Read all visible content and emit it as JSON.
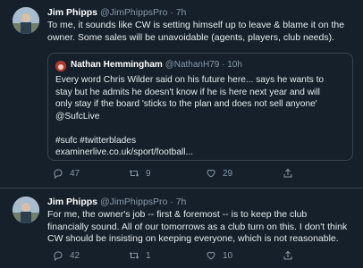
{
  "tweets": [
    {
      "name": "Jim Phipps",
      "handle": "@JimPhippsPro",
      "separator": "·",
      "time": "7h",
      "text": "To me, it sounds like CW is setting himself up to leave & blame it on the\nowner. Some sales will be unavoidable (agents, players, club needs).",
      "quote": {
        "name": "Nathan Hemmingham",
        "handle": "@NathanH79",
        "separator": "·",
        "time": "10h",
        "text": "Every word Chris Wilder said on his future here... says he wants to\nstay but he admits he doesn't know if he is here next year and will\nonly stay if the board 'sticks to the plan and does not sell anyone'\n@SufcLive\n\n#sufc #twitterblades\nexaminerlive.co.uk/sport/football..."
      },
      "actions": {
        "reply_count": "47",
        "retweet_count": "9",
        "like_count": "29"
      }
    },
    {
      "name": "Jim Phipps",
      "handle": "@JimPhippsPro",
      "separator": "·",
      "time": "7h",
      "text": "For me, the owner's job -- first & foremost -- is to keep the club\nfinancially sound. All of our tomorrows as a club turn on this. I don't think\nCW should be insisting on keeping everyone, which is not reasonable.",
      "actions": {
        "reply_count": "42",
        "retweet_count": "1",
        "like_count": "10"
      }
    }
  ],
  "colors": {
    "background": "#15202b",
    "text": "#e6ecf0",
    "muted": "#8899a6",
    "border": "#38444d"
  },
  "icons": [
    "avatar",
    "reply-icon",
    "retweet-icon",
    "like-icon",
    "share-icon"
  ]
}
